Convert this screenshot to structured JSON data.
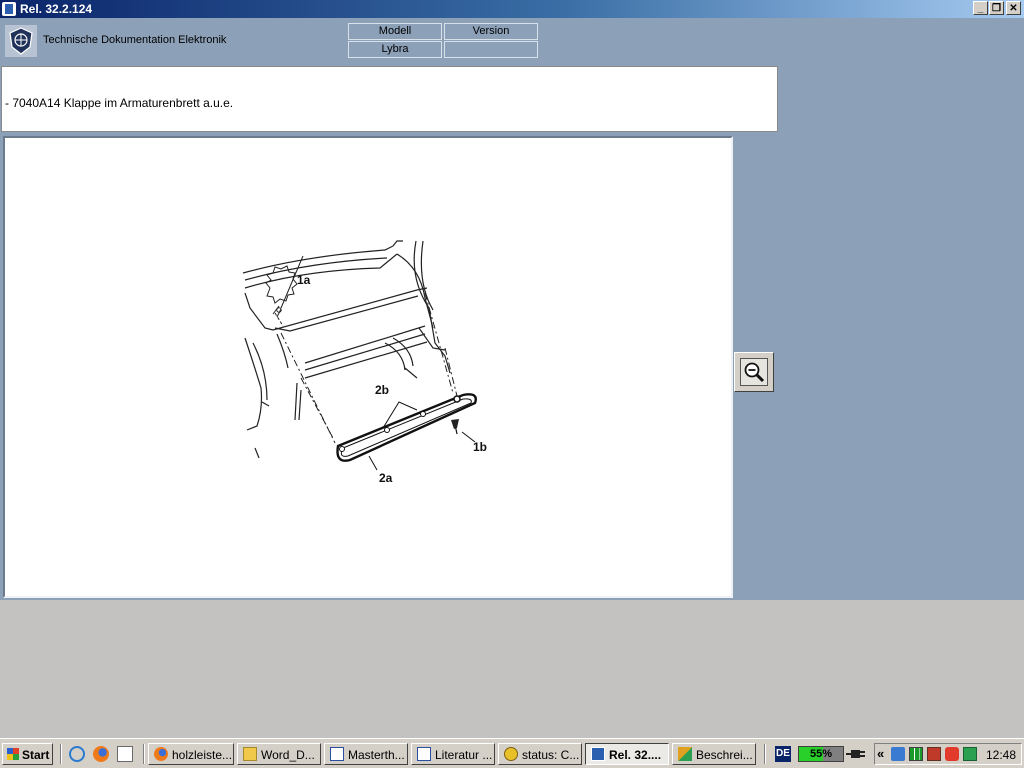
{
  "window": {
    "title": "Rel. 32.2.124"
  },
  "header": {
    "title": "Technische Dokumentation Elektronik",
    "columns": [
      {
        "label": "Modell",
        "value": "Lybra"
      },
      {
        "label": "Version",
        "value": ""
      }
    ]
  },
  "document": {
    "description": "- 7040A14 Klappe im Armaturenbrett a.u.e."
  },
  "drawing": {
    "callouts": {
      "label_1a": "1a",
      "label_1b": "1b",
      "label_2a": "2a",
      "label_2b": "2b"
    }
  },
  "zoom": {
    "icon": "zoom-out-icon"
  },
  "taskbar": {
    "start_label": "Start",
    "quicklaunch": [
      "ie-icon",
      "firefox-icon",
      "desktop-icon"
    ],
    "tasks": [
      {
        "label": "holzleiste...",
        "icon": "firefox-icon"
      },
      {
        "label": "Word_D...",
        "icon": "folder-icon"
      },
      {
        "label": "Masterth...",
        "icon": "word-icon"
      },
      {
        "label": "Literatur ...",
        "icon": "word-icon"
      },
      {
        "label": "status: C...",
        "icon": "chat-icon"
      },
      {
        "label": "Rel. 32....",
        "icon": "app-icon",
        "active": true
      },
      {
        "label": "Beschrei...",
        "icon": "pen-icon"
      }
    ],
    "language": "DE",
    "battery": "55%",
    "clock": "12:48"
  }
}
